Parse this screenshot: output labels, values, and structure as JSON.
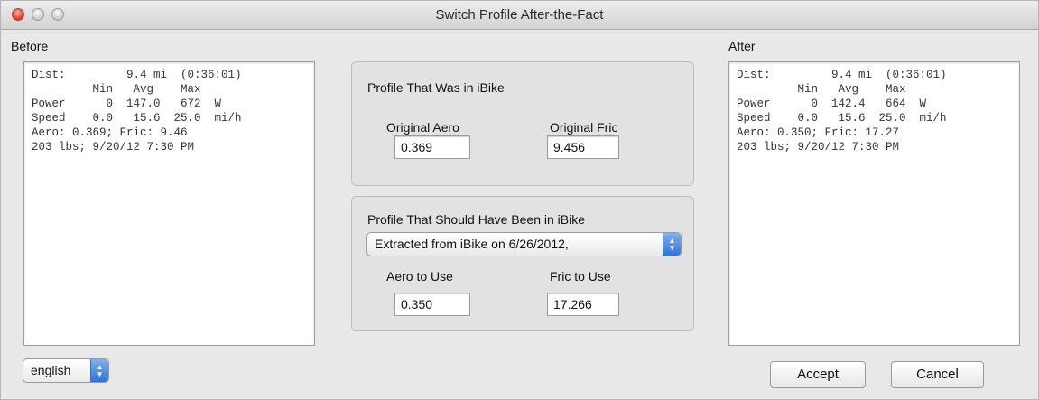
{
  "window": {
    "title": "Switch Profile After-the-Fact"
  },
  "before": {
    "label": "Before",
    "lines": [
      "Dist:         9.4 mi  (0:36:01)",
      "         Min   Avg    Max",
      "Power      0  147.0   672  W",
      "Speed    0.0   15.6  25.0  mi/h",
      "Aero: 0.369; Fric: 9.46",
      "203 lbs; 9/20/12 7:30 PM"
    ]
  },
  "after": {
    "label": "After",
    "lines": [
      "Dist:         9.4 mi  (0:36:01)",
      "         Min   Avg    Max",
      "Power      0  142.4   664  W",
      "Speed    0.0   15.6  25.0  mi/h",
      "Aero: 0.350; Fric: 17.27",
      "203 lbs; 9/20/12 7:30 PM"
    ]
  },
  "original_profile": {
    "title": "Profile That Was in iBike",
    "aero_label": "Original Aero",
    "aero_value": "0.369",
    "fric_label": "Original Fric",
    "fric_value": "9.456"
  },
  "new_profile": {
    "title": "Profile That Should Have Been in iBike",
    "selected_profile": "Extracted from iBike on 6/26/2012,",
    "aero_label": "Aero to Use",
    "aero_value": "0.350",
    "fric_label": "Fric to Use",
    "fric_value": "17.266"
  },
  "language": {
    "selected": "english"
  },
  "buttons": {
    "accept": "Accept",
    "cancel": "Cancel"
  },
  "colors": {
    "popup_arrow": "#2e74d6",
    "close_button": "#e0443a"
  }
}
